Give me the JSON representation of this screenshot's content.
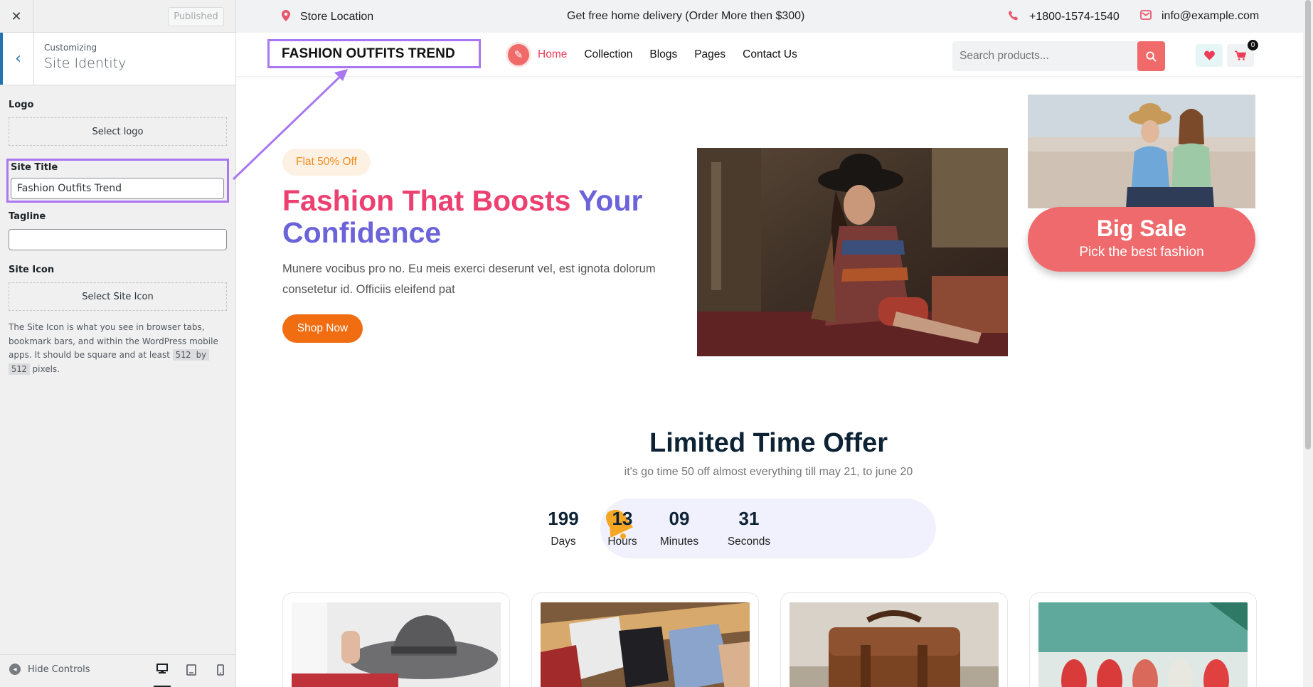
{
  "customizer": {
    "close_icon": "close-icon",
    "published_label": "Published",
    "breadcrumb": "Customizing",
    "section_title": "Site Identity",
    "logo_label": "Logo",
    "select_logo": "Select logo",
    "site_title_label": "Site Title",
    "site_title_value": "Fashion Outfits Trend",
    "tagline_label": "Tagline",
    "tagline_value": "",
    "site_icon_label": "Site Icon",
    "select_site_icon": "Select Site Icon",
    "desc_part1": "The Site Icon is what you see in browser tabs, bookmark bars, and within the WordPress mobile apps. It should be square and at least",
    "desc_code1": "512 by",
    "desc_code2": "512",
    "desc_part2": "pixels.",
    "hide_controls": "Hide Controls",
    "devices": [
      "desktop",
      "tablet",
      "mobile"
    ],
    "active_device": "desktop",
    "accent": "#2271b1"
  },
  "topbar": {
    "store": "Store Location",
    "promo": "Get free home delivery (Order More then $300)",
    "phone": "+1800-1574-1540",
    "email": "info@example.com"
  },
  "header": {
    "site_title": "FASHION OUTFITS TREND",
    "nav": [
      "Home",
      "Collection",
      "Blogs",
      "Pages",
      "Contact Us"
    ],
    "active_nav": "Home",
    "search_placeholder": "Search products...",
    "cart_count": "0"
  },
  "hero": {
    "badge": "Flat 50% Off",
    "heading_pink": "Fashion That Boosts",
    "heading_purple_1": "Your",
    "heading_purple_2": "Confidence",
    "paragraph": "Munere vocibus pro no. Eu meis exerci deserunt vel, est ignota dolorum consetetur id. Officiis eleifend pat",
    "cta": "Shop Now"
  },
  "sale": {
    "title": "Big Sale",
    "subtitle": "Pick the best fashion"
  },
  "offer": {
    "title": "Limited Time Offer",
    "subtitle": "it's go time 50 off almost everything till may 21, to june 20",
    "timer": [
      {
        "value": "199",
        "label": "Days"
      },
      {
        "value": "13",
        "label": "Hours"
      },
      {
        "value": "09",
        "label": "Minutes"
      },
      {
        "value": "31",
        "label": "Seconds"
      }
    ]
  },
  "colors": {
    "brand_pink": "#ec4071",
    "brand_purple": "#6b63d9",
    "highlight": "#a977f0",
    "sale": "#ef6a6c",
    "cta": "#f06d12"
  }
}
